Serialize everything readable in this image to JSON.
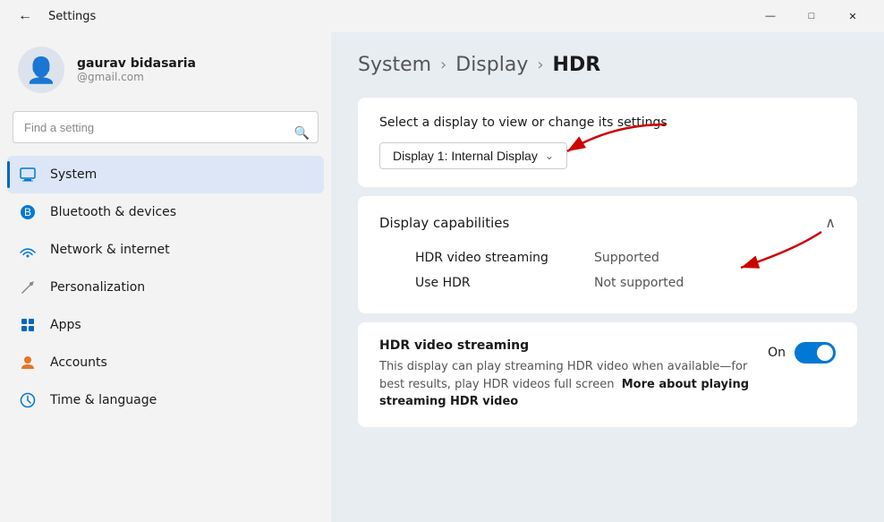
{
  "titleBar": {
    "title": "Settings",
    "backLabel": "←",
    "minimizeLabel": "—",
    "maximizeLabel": "□",
    "closeLabel": "✕"
  },
  "user": {
    "name": "gaurav bidasaria",
    "email": "@gmail.com"
  },
  "search": {
    "placeholder": "Find a setting"
  },
  "nav": {
    "items": [
      {
        "id": "system",
        "label": "System",
        "icon": "💻",
        "active": true
      },
      {
        "id": "bluetooth",
        "label": "Bluetooth & devices",
        "icon": "🔵",
        "active": false
      },
      {
        "id": "network",
        "label": "Network & internet",
        "icon": "📶",
        "active": false
      },
      {
        "id": "personalization",
        "label": "Personalization",
        "icon": "✏️",
        "active": false
      },
      {
        "id": "apps",
        "label": "Apps",
        "icon": "🪟",
        "active": false
      },
      {
        "id": "accounts",
        "label": "Accounts",
        "icon": "👤",
        "active": false
      },
      {
        "id": "time",
        "label": "Time & language",
        "icon": "🕐",
        "active": false
      }
    ]
  },
  "breadcrumb": {
    "items": [
      {
        "label": "System",
        "active": false
      },
      {
        "label": "Display",
        "active": false
      },
      {
        "label": "HDR",
        "active": true
      }
    ],
    "separator": "›"
  },
  "displaySelector": {
    "label": "Select a display to view or change its settings",
    "selectedDisplay": "Display 1: Internal Display"
  },
  "capabilities": {
    "title": "Display capabilities",
    "rows": [
      {
        "label": "HDR video streaming",
        "value": "Supported"
      },
      {
        "label": "Use HDR",
        "value": "Not supported"
      }
    ]
  },
  "hdrStreaming": {
    "title": "HDR video streaming",
    "description": "This display can play streaming HDR video when available—for best results, play HDR videos full screen",
    "linkText": "More about playing streaming HDR video",
    "toggleLabel": "On",
    "toggleOn": true
  }
}
